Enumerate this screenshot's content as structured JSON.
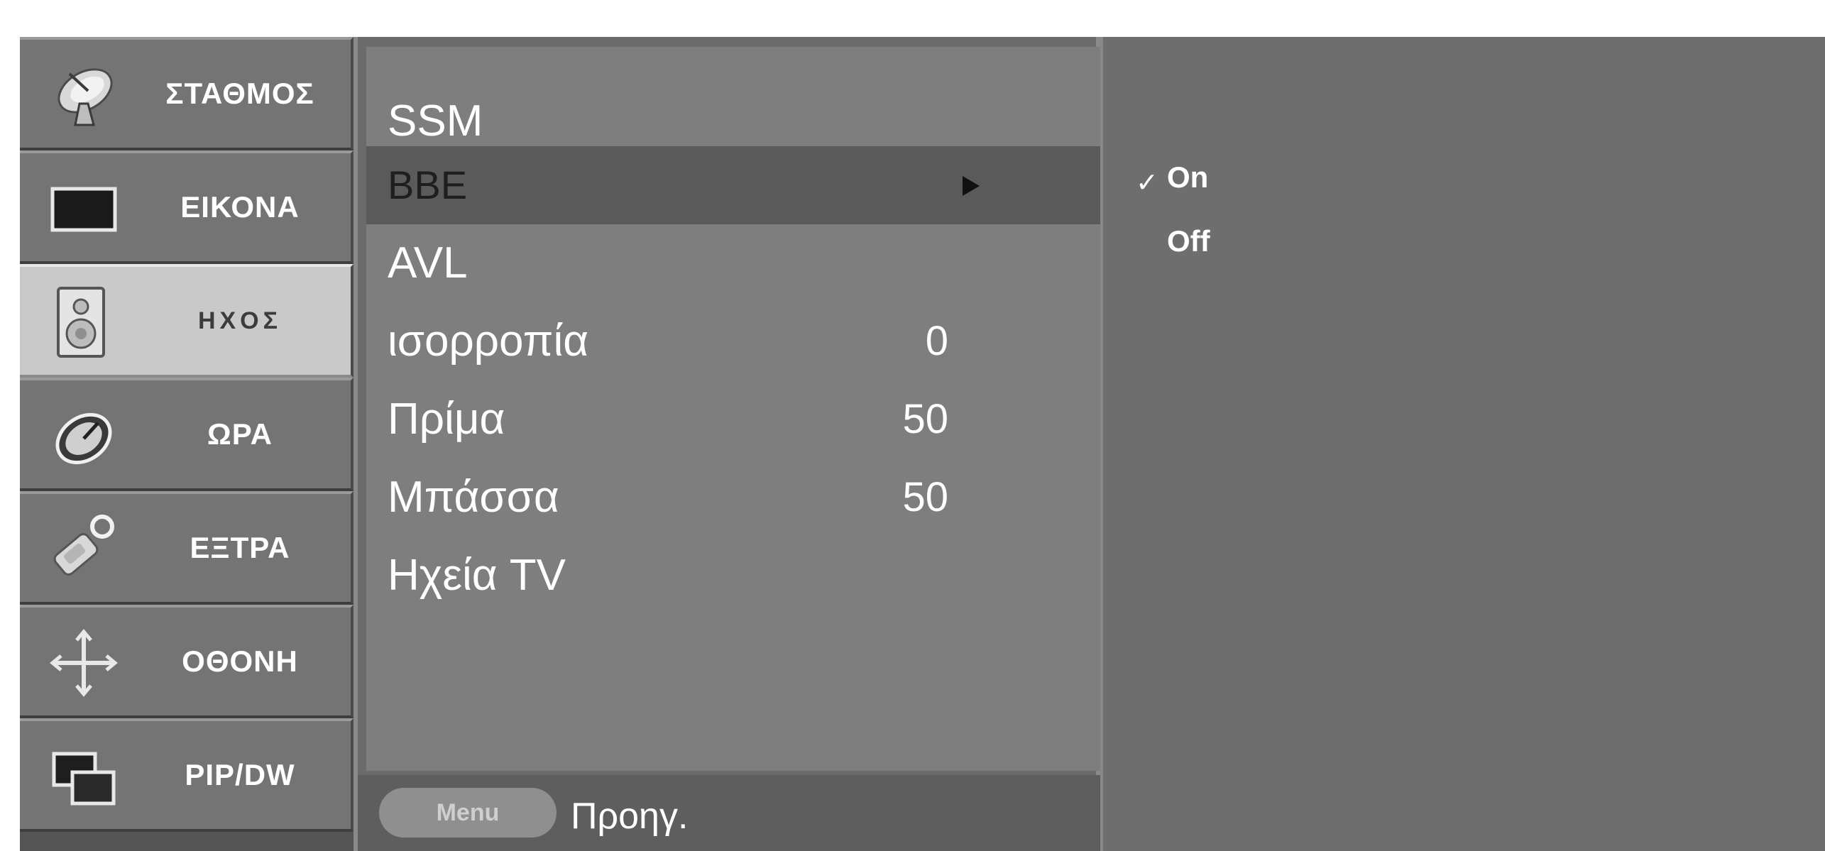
{
  "sidebar": {
    "items": [
      {
        "label": "ΣΤΑΘΜΟΣ",
        "icon": "satellite-dish-icon",
        "selected": false
      },
      {
        "label": "ΕΙΚΟΝΑ",
        "icon": "picture-screen-icon",
        "selected": false
      },
      {
        "label": "ΗΧΟΣ",
        "icon": "speaker-icon",
        "selected": true
      },
      {
        "label": "ΩΡΑ",
        "icon": "clock-icon",
        "selected": false
      },
      {
        "label": "ΕΞΤΡΑ",
        "icon": "extra-tool-icon",
        "selected": false
      },
      {
        "label": "ΟΘΟΝΗ",
        "icon": "screen-adjust-arrows-icon",
        "selected": false
      },
      {
        "label": "PIP/DW",
        "icon": "pip-windows-icon",
        "selected": false
      }
    ]
  },
  "menu": {
    "items": [
      {
        "label": "SSM",
        "value": ""
      },
      {
        "label": "BBE",
        "value": "",
        "highlighted": true,
        "has_submenu": true
      },
      {
        "label": "AVL",
        "value": ""
      },
      {
        "label": "ισορροπία",
        "value": "0"
      },
      {
        "label": "Πρίμα",
        "value": "50"
      },
      {
        "label": "Μπάσσα",
        "value": "50"
      },
      {
        "label": "Ηχεία TV",
        "value": ""
      }
    ],
    "footer": {
      "button_label": "Menu",
      "back_label": "Προηγ."
    }
  },
  "submenu": {
    "options": [
      {
        "label": "On",
        "checked": true
      },
      {
        "label": "Off",
        "checked": false
      }
    ],
    "check_symbol": "✓"
  },
  "colors": {
    "background": "#ffffff",
    "panel": "#6e6e6e",
    "sidebar_item": "#747474",
    "sidebar_selected": "#c9c9c9",
    "menu_highlight": "#5a5a5a",
    "text": "#ffffff"
  }
}
